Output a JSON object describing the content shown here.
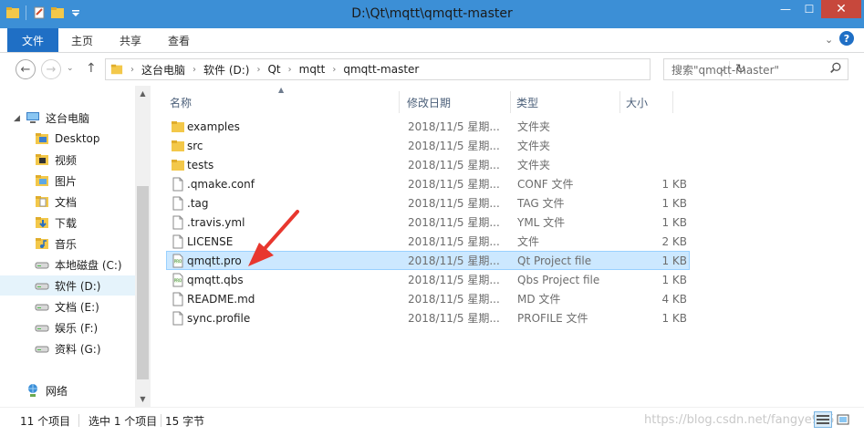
{
  "window": {
    "title": "D:\\Qt\\mqtt\\qmqtt-master",
    "minimize": "—",
    "maximize": "☐",
    "close": "✕"
  },
  "ribbon": {
    "tabs": [
      "文件",
      "主页",
      "共享",
      "查看"
    ],
    "collapse": "⌄",
    "help": "?"
  },
  "address": {
    "back": "←",
    "forward": "→",
    "recent": "⌄",
    "up": "↑",
    "crumbs": [
      "这台电脑",
      "软件 (D:)",
      "Qt",
      "mqtt",
      "qmqtt-master"
    ],
    "dropdown": "⌄",
    "refresh": "↻",
    "search_placeholder": "搜索\"qmqtt-master\"",
    "search_icon": "magnifier-icon"
  },
  "navpane": {
    "items": [
      {
        "label": "这台电脑",
        "icon": "computer-icon"
      },
      {
        "label": "Desktop",
        "icon": "folder-icon"
      },
      {
        "label": "视频",
        "icon": "video-folder-icon"
      },
      {
        "label": "图片",
        "icon": "picture-folder-icon"
      },
      {
        "label": "文档",
        "icon": "document-folder-icon"
      },
      {
        "label": "下载",
        "icon": "download-folder-icon"
      },
      {
        "label": "音乐",
        "icon": "music-folder-icon"
      },
      {
        "label": "本地磁盘 (C:)",
        "icon": "drive-icon"
      },
      {
        "label": "软件 (D:)",
        "icon": "drive-icon"
      },
      {
        "label": "文档 (E:)",
        "icon": "drive-icon"
      },
      {
        "label": "娱乐 (F:)",
        "icon": "drive-icon"
      },
      {
        "label": "资料 (G:)",
        "icon": "drive-icon"
      },
      {
        "label": "网络",
        "icon": "network-icon"
      }
    ],
    "selected_index": 8
  },
  "columns": {
    "name": "名称",
    "date": "修改日期",
    "type": "类型",
    "size": "大小"
  },
  "files": [
    {
      "name": "examples",
      "date": "2018/11/5 星期...",
      "type": "文件夹",
      "size": "",
      "icon": "folder"
    },
    {
      "name": "src",
      "date": "2018/11/5 星期...",
      "type": "文件夹",
      "size": "",
      "icon": "folder"
    },
    {
      "name": "tests",
      "date": "2018/11/5 星期...",
      "type": "文件夹",
      "size": "",
      "icon": "folder"
    },
    {
      "name": ".qmake.conf",
      "date": "2018/11/5 星期...",
      "type": "CONF 文件",
      "size": "1 KB",
      "icon": "file"
    },
    {
      "name": ".tag",
      "date": "2018/11/5 星期...",
      "type": "TAG 文件",
      "size": "1 KB",
      "icon": "file"
    },
    {
      "name": ".travis.yml",
      "date": "2018/11/5 星期...",
      "type": "YML 文件",
      "size": "1 KB",
      "icon": "file"
    },
    {
      "name": "LICENSE",
      "date": "2018/11/5 星期...",
      "type": "文件",
      "size": "2 KB",
      "icon": "file"
    },
    {
      "name": "qmqtt.pro",
      "date": "2018/11/5 星期...",
      "type": "Qt Project file",
      "size": "1 KB",
      "icon": "qt-project"
    },
    {
      "name": "qmqtt.qbs",
      "date": "2018/11/5 星期...",
      "type": "Qbs Project file",
      "size": "1 KB",
      "icon": "qt-project"
    },
    {
      "name": "README.md",
      "date": "2018/11/5 星期...",
      "type": "MD 文件",
      "size": "4 KB",
      "icon": "file"
    },
    {
      "name": "sync.profile",
      "date": "2018/11/5 星期...",
      "type": "PROFILE 文件",
      "size": "1 KB",
      "icon": "file"
    }
  ],
  "selected_file_index": 7,
  "status": {
    "item_count": "11 个项目",
    "selected": "选中 1 个项目",
    "size": "15 字节",
    "watermark": "https://blog.csdn.net/fangye945"
  },
  "colors": {
    "titlebar": "#3c8fd6",
    "file_tab": "#1f6fc5",
    "selection": "#cce8ff",
    "annotation_arrow": "#e8372e"
  }
}
